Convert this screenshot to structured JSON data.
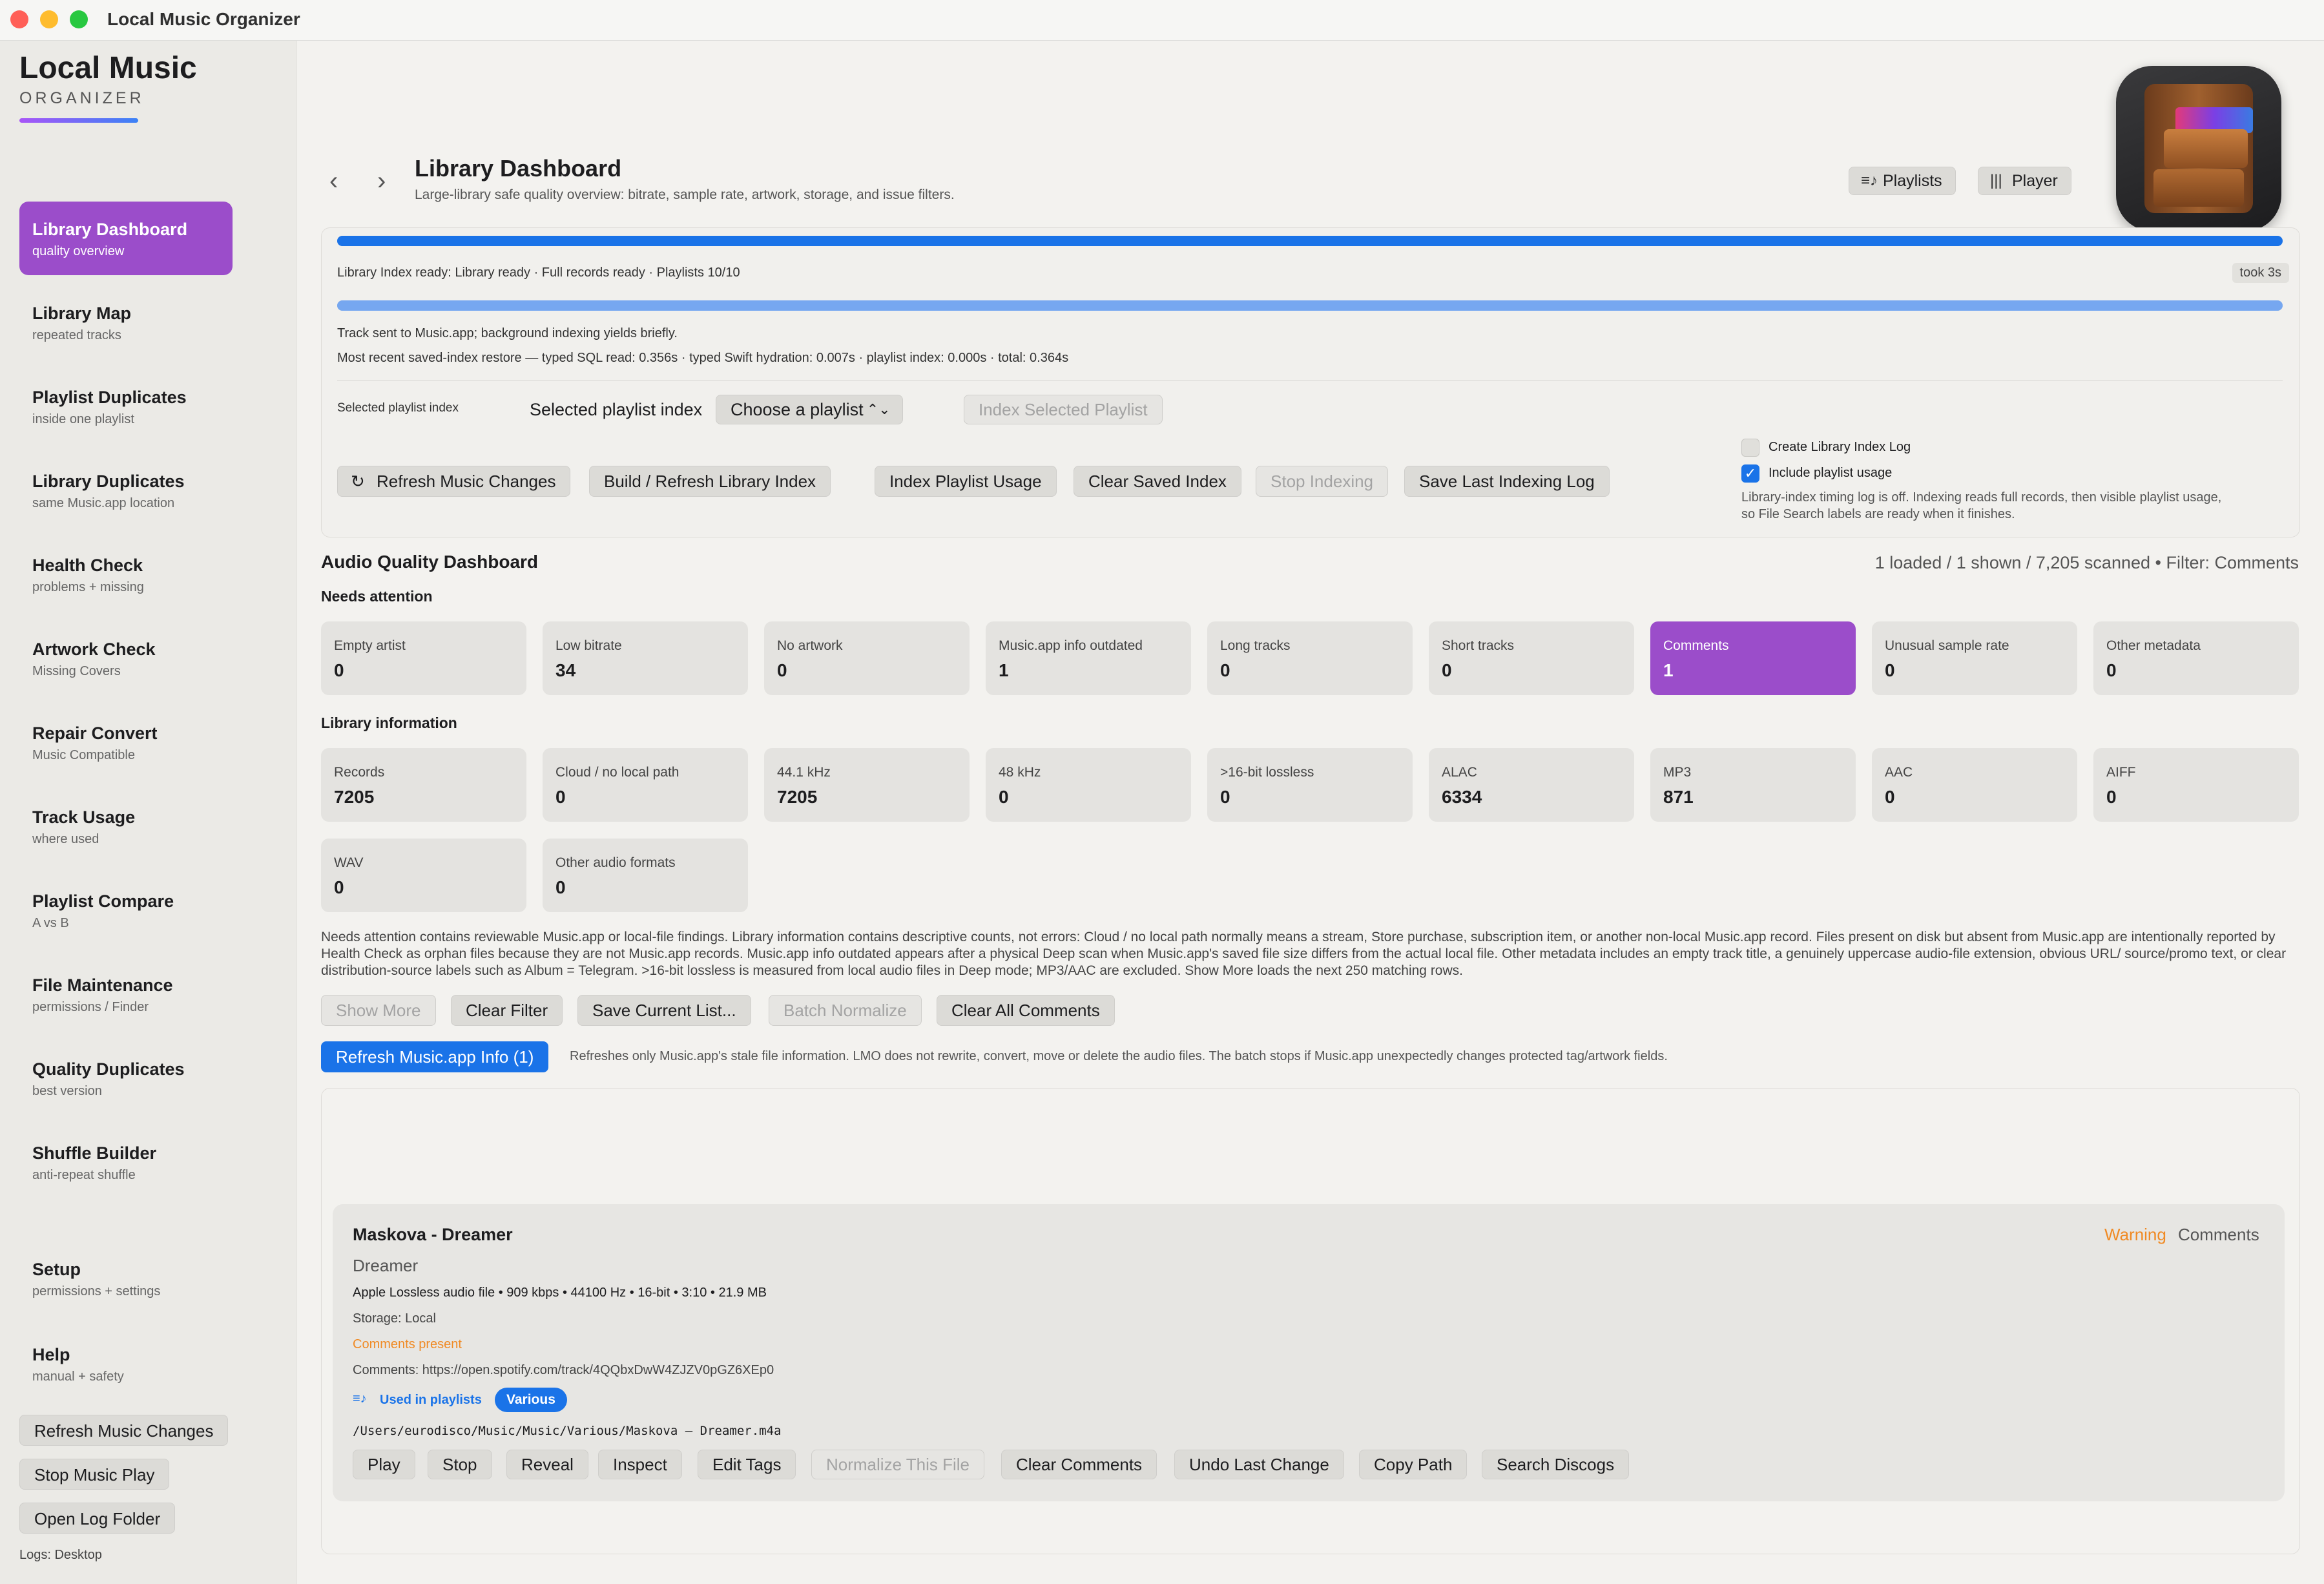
{
  "window": {
    "title": "Local Music Organizer"
  },
  "sidebar": {
    "brand": {
      "name": "Local Music",
      "sub": "ORGANIZER"
    },
    "items": [
      {
        "label": "Library Dashboard",
        "sub": "quality overview"
      },
      {
        "label": "Library Map",
        "sub": "repeated tracks"
      },
      {
        "label": "Playlist Duplicates",
        "sub": "inside one playlist"
      },
      {
        "label": "Library Duplicates",
        "sub": "same Music.app location"
      },
      {
        "label": "Health Check",
        "sub": "problems + missing"
      },
      {
        "label": "Artwork Check",
        "sub": "Missing Covers"
      },
      {
        "label": "Repair Convert",
        "sub": "Music Compatible"
      },
      {
        "label": "Track Usage",
        "sub": "where used"
      },
      {
        "label": "Playlist Compare",
        "sub": "A vs B"
      },
      {
        "label": "File Maintenance",
        "sub": "permissions / Finder"
      },
      {
        "label": "Quality Duplicates",
        "sub": "best version"
      },
      {
        "label": "Shuffle Builder",
        "sub": "anti-repeat shuffle"
      },
      {
        "label": "Setup",
        "sub": "permissions + settings"
      },
      {
        "label": "Help",
        "sub": "manual + safety"
      }
    ],
    "buttons": {
      "refresh": "Refresh Music Changes",
      "stop": "Stop Music Play",
      "open_log": "Open Log Folder"
    },
    "logs": "Logs: Desktop"
  },
  "header": {
    "title": "Library Dashboard",
    "subtitle": "Large-library safe quality overview: bitrate, sample rate, artwork, storage, and issue filters.",
    "playlists": "Playlists",
    "player": "Player"
  },
  "index_panel": {
    "status": "Library Index ready: Library ready · Full records ready · Playlists 10/10",
    "took": "took 3s",
    "progress1": 1.0,
    "progress2": 1.0,
    "line1": "Track sent to Music.app; background indexing yields briefly.",
    "line2": "Most recent saved-index restore — typed SQL read: 0.356s · typed Swift hydration: 0.007s · playlist index: 0.000s · total: 0.364s",
    "playlist_small_label": "Selected playlist index",
    "playlist_label": "Selected playlist index",
    "playlist_select": "Choose a playlist",
    "index_selected": "Index Selected Playlist",
    "buttons": {
      "refresh": "Refresh Music Changes",
      "build": "Build / Refresh Library Index",
      "index_usage": "Index Playlist Usage",
      "clear_saved": "Clear Saved Index",
      "stop": "Stop Indexing",
      "save_log": "Save Last Indexing Log"
    },
    "create_log": "Create Library Index Log",
    "include_usage": "Include playlist usage",
    "note_line1": "Library-index timing log is off. Indexing reads full records, then visible playlist usage,",
    "note_line2": "so File Search labels are ready when it finishes."
  },
  "dashboard": {
    "title": "Audio Quality Dashboard",
    "summary": "1 loaded / 1 shown / 7,205 scanned • Filter: Comments",
    "needs_attention": "Needs attention",
    "attention_cards": [
      {
        "label": "Empty artist",
        "value": "0"
      },
      {
        "label": "Low bitrate",
        "value": "34"
      },
      {
        "label": "No artwork",
        "value": "0"
      },
      {
        "label": "Music.app info outdated",
        "value": "1"
      },
      {
        "label": "Long tracks",
        "value": "0"
      },
      {
        "label": "Short tracks",
        "value": "0"
      },
      {
        "label": "Comments",
        "value": "1"
      },
      {
        "label": "Unusual sample rate",
        "value": "0"
      },
      {
        "label": "Other metadata",
        "value": "0"
      }
    ],
    "library_info": "Library information",
    "info_cards": [
      {
        "label": "Records",
        "value": "7205"
      },
      {
        "label": "Cloud / no local path",
        "value": "0"
      },
      {
        "label": "44.1 kHz",
        "value": "7205"
      },
      {
        "label": "48 kHz",
        "value": "0"
      },
      {
        "label": ">16-bit lossless",
        "value": "0"
      },
      {
        "label": "ALAC",
        "value": "6334"
      },
      {
        "label": "MP3",
        "value": "871"
      },
      {
        "label": "AAC",
        "value": "0"
      },
      {
        "label": "AIFF",
        "value": "0"
      },
      {
        "label": "WAV",
        "value": "0"
      },
      {
        "label": "Other audio formats",
        "value": "0"
      }
    ],
    "explanation": "Needs attention contains reviewable Music.app or local-file findings. Library information contains descriptive counts, not errors: Cloud / no local path normally means a stream, Store purchase, subscription item, or another non-local Music.app record. Files present on disk but absent from Music.app are intentionally reported by Health Check as orphan files because they are not Music.app records. Music.app info outdated appears after a physical Deep scan when Music.app's saved file size differs from the actual local file. Other metadata includes an empty track title, a genuinely uppercase audio-file extension, obvious URL/ source/promo text, or clear distribution-source labels such as Album = Telegram. >16-bit lossless is measured from local audio files in Deep mode; MP3/AAC are excluded. Show More loads the next 250 matching rows.",
    "buttons": {
      "show_more": "Show More",
      "clear_filter": "Clear Filter",
      "save_list": "Save Current List...",
      "batch_normalize": "Batch Normalize",
      "clear_comments": "Clear All Comments"
    },
    "refresh_info": "Refresh Music.app Info (1)",
    "refresh_note": "Refreshes only Music.app's stale file information. LMO does not rewrite, convert, move or delete the audio files. The batch stops if Music.app unexpectedly changes protected tag/artwork fields."
  },
  "track": {
    "title": "Maskova - Dreamer",
    "album": "Dreamer",
    "warning": "Warning",
    "filter": "Comments",
    "format": "Apple Lossless audio file • 909 kbps • 44100 Hz • 16-bit • 3:10 • 21.9 MB",
    "storage": "Storage: Local",
    "comments_present": "Comments present",
    "comments": "Comments: https://open.spotify.com/track/4QQbxDwW4ZJZV0pGZ6XEp0",
    "used_in": "Used in playlists",
    "badge": "Various",
    "path": "/Users/eurodisco/Music/Music/Various/Maskova – Dreamer.m4a",
    "buttons": {
      "play": "Play",
      "stop": "Stop",
      "reveal": "Reveal",
      "inspect": "Inspect",
      "edit_tags": "Edit Tags",
      "normalize": "Normalize This File",
      "clear_comments": "Clear Comments",
      "undo": "Undo Last Change",
      "copy_path": "Copy Path",
      "search_discogs": "Search Discogs"
    }
  },
  "colors": {
    "accent_purple": "#9b4dca",
    "accent_blue": "#1a73e8",
    "warning_orange": "#f08a24"
  }
}
